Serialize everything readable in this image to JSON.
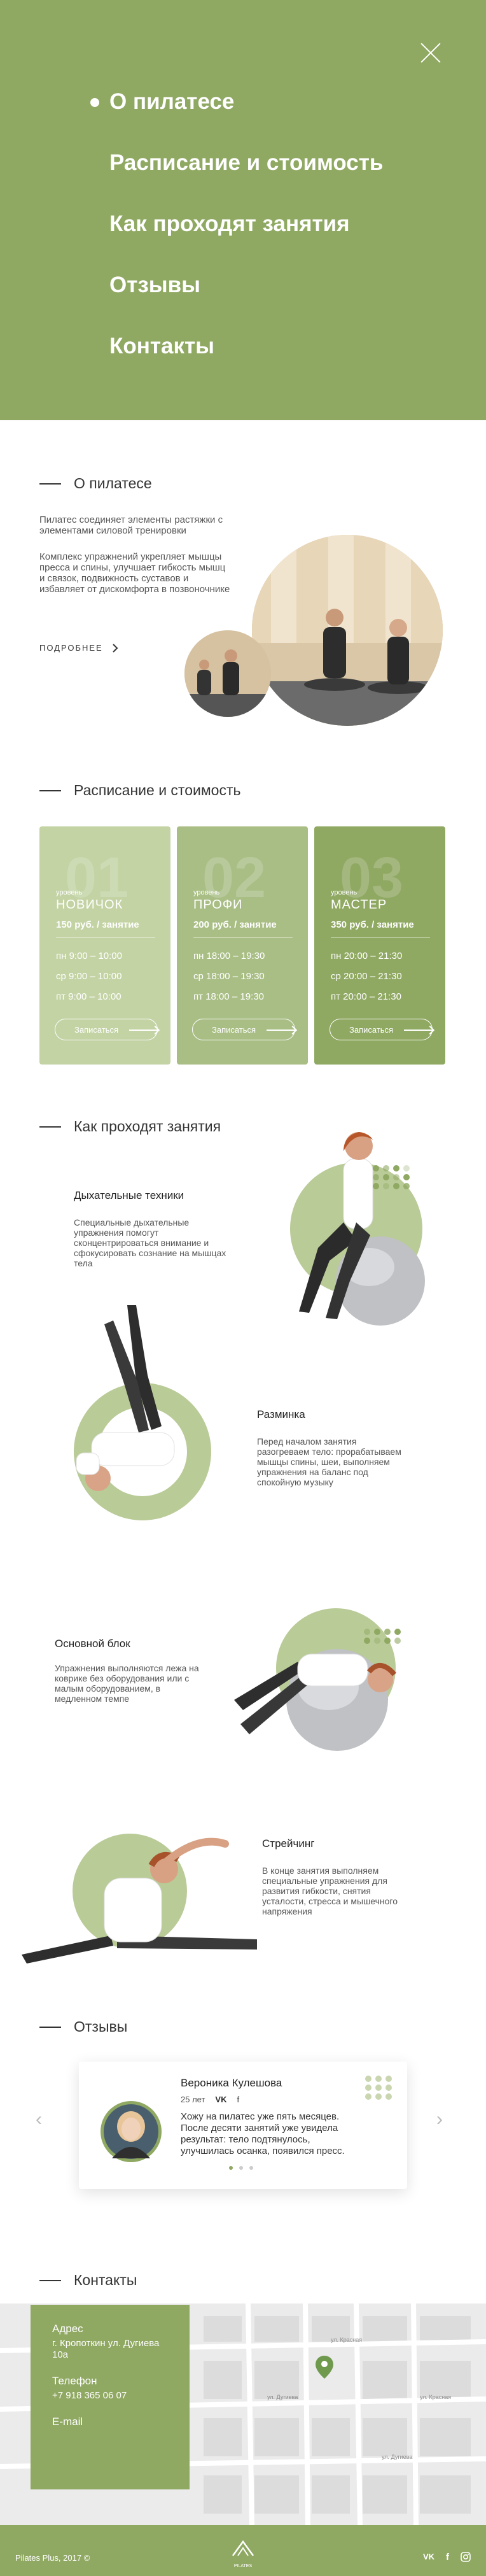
{
  "menu": {
    "items": [
      "О пилатесе",
      "Расписание и стоимость",
      "Как проходят занятия",
      "Отзывы",
      "Контакты"
    ]
  },
  "about": {
    "heading": "О пилатесе",
    "para1": "Пилатес соединяет элементы растяжки с элементами силовой тренировки",
    "para2": "Комплекс упражнений укрепляет мышцы пресса и спины, улучшает гибкость мышц и связок, подвижность суставов и избавляет от дискомфорта в позвоночнике",
    "more": "ПОДРОБНЕЕ"
  },
  "pricing": {
    "heading": "Расписание и стоимость",
    "cards": [
      {
        "num": "01",
        "level": "уровень",
        "name": "НОВИЧОК",
        "price": "150 руб. / занятие",
        "schedule": [
          "пн 9:00 – 10:00",
          "ср 9:00 – 10:00",
          "пт 9:00 – 10:00"
        ],
        "button": "Записаться",
        "color": "#c3d3a4"
      },
      {
        "num": "02",
        "level": "уровень",
        "name": "ПРОФИ",
        "price": "200 руб. / занятие",
        "schedule": [
          "пн 18:00 – 19:30",
          "ср 18:00 – 19:30",
          "пт 18:00 – 19:30"
        ],
        "button": "Записаться",
        "color": "#a9be85"
      },
      {
        "num": "03",
        "level": "уровень",
        "name": "МАСТЕР",
        "price": "350 руб. / занятие",
        "schedule": [
          "пн 20:00 – 21:30",
          "ср 20:00 – 21:30",
          "пт 20:00 – 21:30"
        ],
        "button": "Записаться",
        "color": "#8fa862"
      }
    ]
  },
  "steps": {
    "heading": "Как проходят занятия",
    "items": [
      {
        "title": "Дыхательные техники",
        "text": "Специальные дыхательные упражнения помогут сконцентрироваться внимание и сфокусировать сознание на мышцах тела"
      },
      {
        "title": "Разминка",
        "text": "Перед началом занятия разогреваем тело: прорабатываем мышцы спины, шеи, выполняем упражнения на баланс под спокойную музыку"
      },
      {
        "title": "Основной блок",
        "text": "Упражнения выполняются лежа на коврике без оборудования или с малым оборудованием, в медленном темпе"
      },
      {
        "title": "Стрейчинг",
        "text": "В конце занятия выполняем специальные упражнения для развития гибкости, снятия усталости, стресса и мышечного напряжения"
      }
    ]
  },
  "reviews": {
    "heading": "Отзывы",
    "name": "Вероника Кулешова",
    "age": "25 лет",
    "text": "Хожу на пилатес уже пять месяцев. После десяти занятий уже увидела результат: тело подтянулось, улучшилась осанка, появился пресс."
  },
  "contacts": {
    "heading": "Контакты",
    "address_label": "Адрес",
    "address": "г. Кропоткин ул. Дугиева 10а",
    "phone_label": "Телефон",
    "phone": "+7 918 365 06 07",
    "email_label": "E-mail",
    "streets": [
      "ул. Красная",
      "ул. Дугиева",
      "ул. Красная",
      "ул. Дугиева"
    ]
  },
  "footer": {
    "copy": "Pilates Plus, 2017",
    "logo_text": "PILATES",
    "social": [
      "vk-icon",
      "facebook-icon",
      "instagram-icon"
    ]
  },
  "colors": {
    "accent": "#8fa862"
  }
}
